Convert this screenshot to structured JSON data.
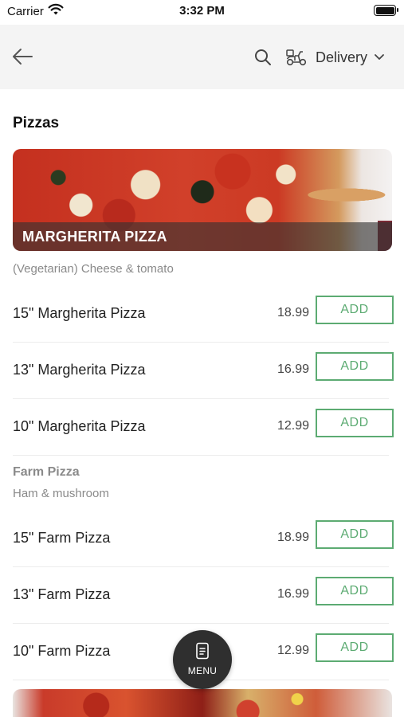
{
  "status_bar": {
    "carrier": "Carrier",
    "time": "3:32 PM",
    "battery_level": 1.0
  },
  "nav": {
    "back_icon": "arrow-left-icon",
    "search_icon": "search-icon",
    "delivery_icon": "scooter-icon",
    "delivery_label": "Delivery",
    "chevron_icon": "chevron-down-icon"
  },
  "section_title": "Pizzas",
  "groups": [
    {
      "banner_title": "MARGHERITA PIZZA",
      "description": "(Vegetarian) Cheese & tomato",
      "items": [
        {
          "name": "15\" Margherita Pizza",
          "price": "18.99",
          "button": "ADD"
        },
        {
          "name": "13\" Margherita Pizza",
          "price": "16.99",
          "button": "ADD"
        },
        {
          "name": "10\" Margherita Pizza",
          "price": "12.99",
          "button": "ADD"
        }
      ]
    },
    {
      "title": "Farm Pizza",
      "description": "Ham & mushroom",
      "items": [
        {
          "name": "15\" Farm Pizza",
          "price": "18.99",
          "button": "ADD"
        },
        {
          "name": "13\" Farm Pizza",
          "price": "16.99",
          "button": "ADD"
        },
        {
          "name": "10\" Farm Pizza",
          "price": "12.99",
          "button": "ADD"
        }
      ]
    }
  ],
  "menu_button": {
    "label": "MENU",
    "icon": "menu-card-icon"
  },
  "colors": {
    "accent": "#5cab72",
    "nav_background": "#f4f4f4",
    "fab_background": "#2f2f2f"
  }
}
